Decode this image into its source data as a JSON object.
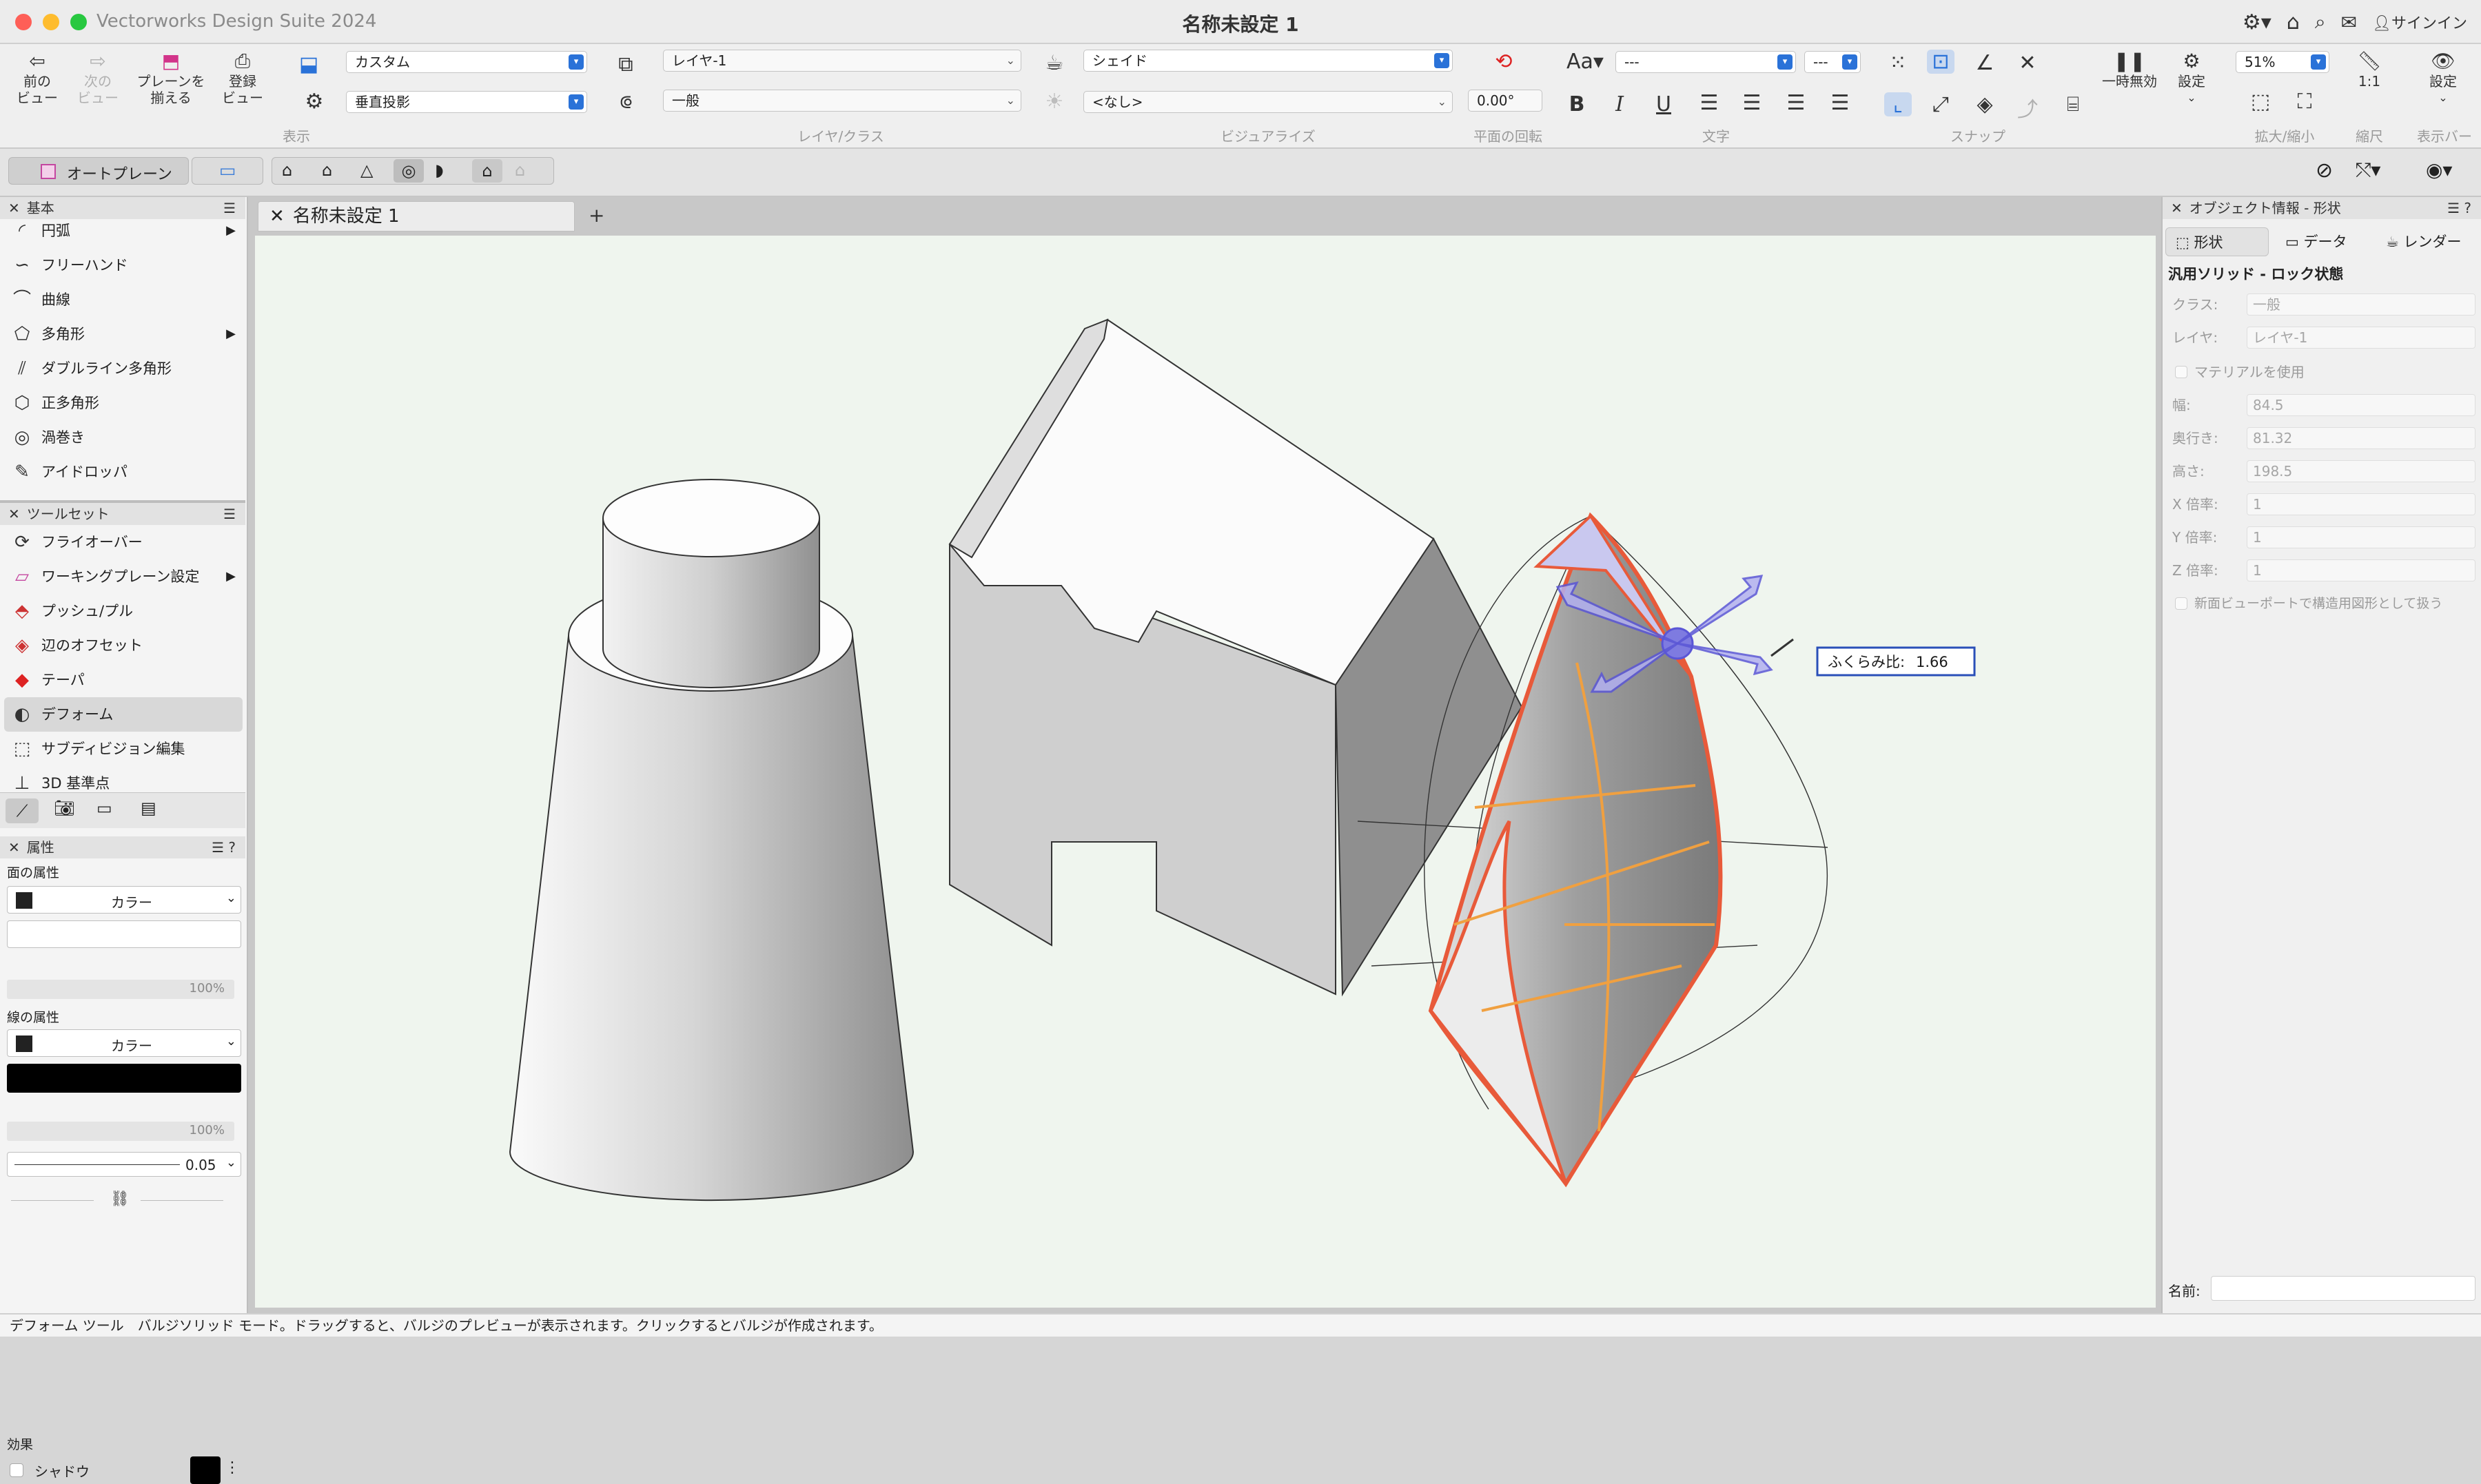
{
  "app": {
    "name": "Vectorworks Design Suite 2024",
    "document_title": "名称未設定 1"
  },
  "titlebar_right": {
    "signin": "サインイン"
  },
  "toolbar": {
    "prev_view": "前の\nビュー",
    "next_view": "次の\nビュー",
    "align_plane": "プレーンを\n揃える",
    "save_view": "登録\nビュー",
    "view_label": "表示",
    "view_dropdown": "カスタム",
    "projection_dropdown": "垂直投影",
    "layer_dropdown": "レイヤ-1",
    "class_dropdown": "一般",
    "layer_class_label": "レイヤ/クラス",
    "render_dropdown": "シェイド",
    "lighting_dropdown": "<なし>",
    "visualize_label": "ビジュアライズ",
    "rotation_value": "0.00°",
    "rotation_label": "平面の回転",
    "text_label": "文字",
    "font_dropdown": "---",
    "size_dropdown": "---",
    "snap_label": "スナップ",
    "pause_label": "一時無効",
    "settings_label": "設定",
    "zoom_value": "51%",
    "zoom_label": "拡大/縮小",
    "scale_label": "縮尺",
    "scale_value": "1:1",
    "displaybar_label": "表示バー",
    "displaybar_settings": "設定"
  },
  "subbar": {
    "plane_mode": "オートプレーン"
  },
  "palettes": {
    "basic": {
      "title": "基本",
      "items": [
        {
          "label": "円弧",
          "submenu": true
        },
        {
          "label": "フリーハンド",
          "submenu": false
        },
        {
          "label": "曲線",
          "submenu": false
        },
        {
          "label": "多角形",
          "submenu": true
        },
        {
          "label": "ダブルライン多角形",
          "submenu": false
        },
        {
          "label": "正多角形",
          "submenu": false
        },
        {
          "label": "渦巻き",
          "submenu": false
        },
        {
          "label": "アイドロッパ",
          "submenu": false
        }
      ]
    },
    "toolset": {
      "title": "ツールセット",
      "items": [
        {
          "label": "フライオーバー",
          "submenu": false
        },
        {
          "label": "ワーキングプレーン設定",
          "submenu": true
        },
        {
          "label": "プッシュ/プル",
          "submenu": false
        },
        {
          "label": "辺のオフセット",
          "submenu": false
        },
        {
          "label": "テーパ",
          "submenu": false
        },
        {
          "label": "デフォーム",
          "submenu": false,
          "selected": true
        },
        {
          "label": "サブディビジョン編集",
          "submenu": false
        },
        {
          "label": "3D 基準点",
          "submenu": false
        }
      ]
    },
    "attributes": {
      "title": "属性",
      "fill_label": "面の属性",
      "fill_type": "カラー",
      "fill_opacity": "100%",
      "line_label": "線の属性",
      "line_type": "カラー",
      "line_opacity": "100%",
      "line_weight": "0.05",
      "effects_label": "効果",
      "shadow_label": "シャドウ"
    }
  },
  "canvas": {
    "tab_label": "名称未設定 1",
    "bulge_tooltip_label": "ふくらみ比:",
    "bulge_tooltip_value": "1.66"
  },
  "obj_info": {
    "title": "オブジェクト情報 - 形状",
    "tabs": [
      "形状",
      "データ",
      "レンダー"
    ],
    "object_type": "汎用ソリッド - ロック状態",
    "class_label": "クラス:",
    "class_value": "一般",
    "layer_label": "レイヤ:",
    "layer_value": "レイヤ-1",
    "use_material": "マテリアルを使用",
    "width_label": "幅:",
    "width_value": "84.5",
    "depth_label": "奥行き:",
    "depth_value": "81.32",
    "height_label": "高さ:",
    "height_value": "198.5",
    "xscale_label": "X 倍率:",
    "xscale_value": "1",
    "yscale_label": "Y 倍率:",
    "yscale_value": "1",
    "zscale_label": "Z 倍率:",
    "zscale_value": "1",
    "new_viewport_option": "新面ビューポートで構造用図形として扱う",
    "name_label": "名前:"
  },
  "status": {
    "text": "デフォーム ツール　バルジソリッド モード。ドラッグすると、バルジのプレビューが表示されます。クリックするとバルジが作成されます。"
  }
}
